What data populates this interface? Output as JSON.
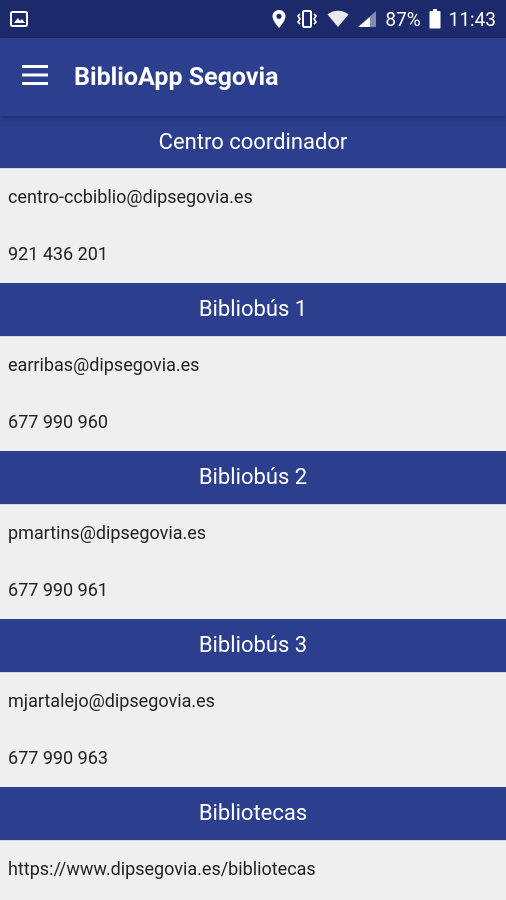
{
  "status_bar": {
    "battery": "87%",
    "time": "11:43",
    "icons": [
      "gallery-icon",
      "location-icon",
      "vibrate-icon",
      "wifi-icon",
      "signal-icon",
      "battery-icon"
    ]
  },
  "app_bar": {
    "title": "BiblioApp Segovia",
    "menu_icon": "hamburger-menu-icon"
  },
  "colors": {
    "primary": "#2c3e8e",
    "status_bar": "#1c2a6b",
    "background": "#efefef"
  },
  "sections": [
    {
      "title": "Centro coordinador",
      "lines": [
        "centro-ccbiblio@dipsegovia.es",
        "921 436 201"
      ]
    },
    {
      "title": "Bibliobús 1",
      "lines": [
        "earribas@dipsegovia.es",
        "677 990 960"
      ]
    },
    {
      "title": "Bibliobús 2",
      "lines": [
        "pmartins@dipsegovia.es",
        "677 990 961"
      ]
    },
    {
      "title": "Bibliobús 3",
      "lines": [
        "mjartalejo@dipsegovia.es",
        "677 990 963"
      ]
    },
    {
      "title": "Bibliotecas",
      "lines": [
        "https://www.dipsegovia.es/bibliotecas"
      ]
    }
  ]
}
